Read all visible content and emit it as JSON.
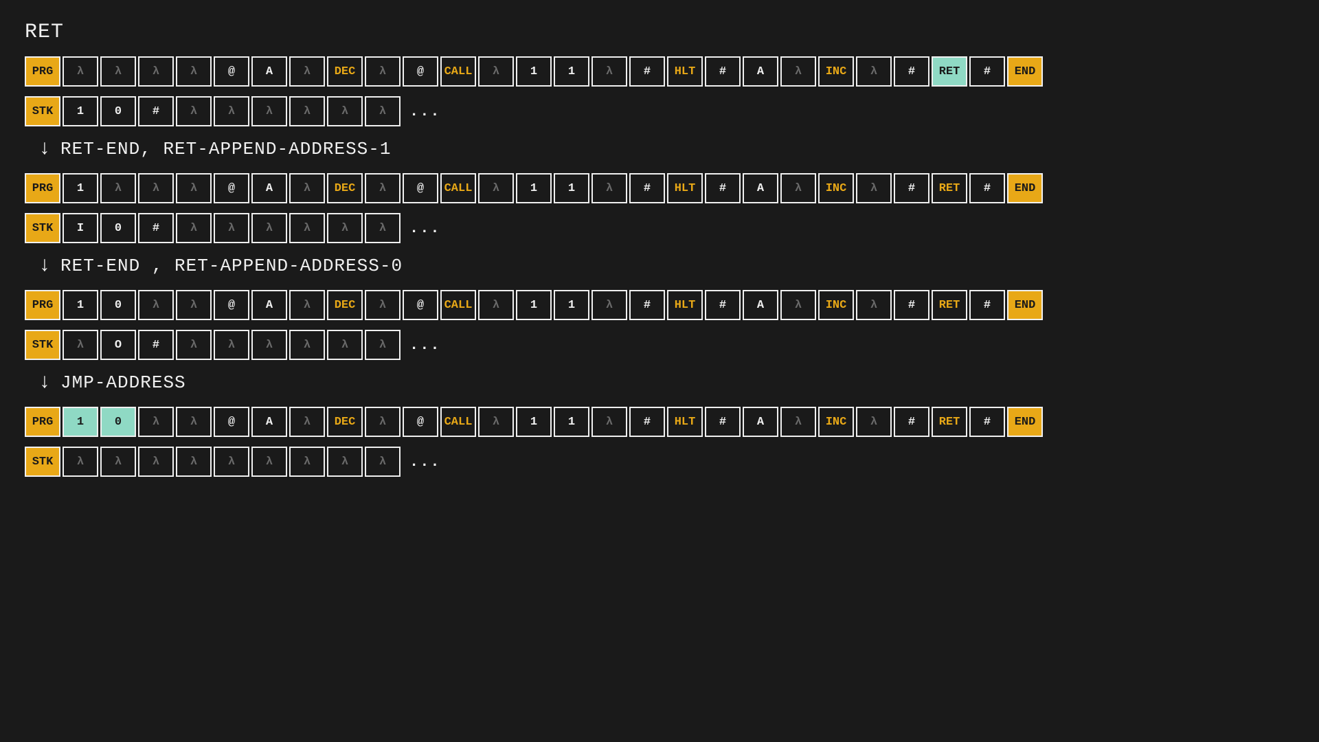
{
  "title": "RET",
  "ellipsis": "...",
  "labels": {
    "prg": "PRG",
    "stk": "STK"
  },
  "transitions": [
    "RET-END, RET-APPEND-ADDRESS-1",
    "RET-END , RET-APPEND-ADDRESS-0",
    "JMP-ADDRESS"
  ],
  "states": [
    {
      "prg": [
        {
          "t": "λ",
          "c": "dim"
        },
        {
          "t": "λ",
          "c": "dim"
        },
        {
          "t": "λ",
          "c": "dim"
        },
        {
          "t": "λ",
          "c": "dim"
        },
        {
          "t": "@",
          "c": ""
        },
        {
          "t": "A",
          "c": ""
        },
        {
          "t": "λ",
          "c": "dim"
        },
        {
          "t": "DEC",
          "c": "yellow"
        },
        {
          "t": "λ",
          "c": "dim"
        },
        {
          "t": "@",
          "c": ""
        },
        {
          "t": "CALL",
          "c": "yellow"
        },
        {
          "t": "λ",
          "c": "dim"
        },
        {
          "t": "1",
          "c": ""
        },
        {
          "t": "1",
          "c": ""
        },
        {
          "t": "λ",
          "c": "dim"
        },
        {
          "t": "#",
          "c": ""
        },
        {
          "t": "HLT",
          "c": "yellow"
        },
        {
          "t": "#",
          "c": ""
        },
        {
          "t": "A",
          "c": ""
        },
        {
          "t": "λ",
          "c": "dim"
        },
        {
          "t": "INC",
          "c": "yellow"
        },
        {
          "t": "λ",
          "c": "dim"
        },
        {
          "t": "#",
          "c": ""
        },
        {
          "t": "RET",
          "c": "highlight"
        },
        {
          "t": "#",
          "c": ""
        },
        {
          "t": "END",
          "c": "end"
        }
      ],
      "stk": [
        {
          "t": "1",
          "c": ""
        },
        {
          "t": "0",
          "c": ""
        },
        {
          "t": "#",
          "c": ""
        },
        {
          "t": "λ",
          "c": "dim"
        },
        {
          "t": "λ",
          "c": "dim"
        },
        {
          "t": "λ",
          "c": "dim"
        },
        {
          "t": "λ",
          "c": "dim"
        },
        {
          "t": "λ",
          "c": "dim"
        },
        {
          "t": "λ",
          "c": "dim"
        }
      ]
    },
    {
      "prg": [
        {
          "t": "1",
          "c": ""
        },
        {
          "t": "λ",
          "c": "dim"
        },
        {
          "t": "λ",
          "c": "dim"
        },
        {
          "t": "λ",
          "c": "dim"
        },
        {
          "t": "@",
          "c": ""
        },
        {
          "t": "A",
          "c": ""
        },
        {
          "t": "λ",
          "c": "dim"
        },
        {
          "t": "DEC",
          "c": "yellow"
        },
        {
          "t": "λ",
          "c": "dim"
        },
        {
          "t": "@",
          "c": ""
        },
        {
          "t": "CALL",
          "c": "yellow"
        },
        {
          "t": "λ",
          "c": "dim"
        },
        {
          "t": "1",
          "c": ""
        },
        {
          "t": "1",
          "c": ""
        },
        {
          "t": "λ",
          "c": "dim"
        },
        {
          "t": "#",
          "c": ""
        },
        {
          "t": "HLT",
          "c": "yellow"
        },
        {
          "t": "#",
          "c": ""
        },
        {
          "t": "A",
          "c": ""
        },
        {
          "t": "λ",
          "c": "dim"
        },
        {
          "t": "INC",
          "c": "yellow"
        },
        {
          "t": "λ",
          "c": "dim"
        },
        {
          "t": "#",
          "c": ""
        },
        {
          "t": "RET",
          "c": "yellow"
        },
        {
          "t": "#",
          "c": ""
        },
        {
          "t": "END",
          "c": "end"
        }
      ],
      "stk": [
        {
          "t": "I",
          "c": ""
        },
        {
          "t": "0",
          "c": ""
        },
        {
          "t": "#",
          "c": ""
        },
        {
          "t": "λ",
          "c": "dim"
        },
        {
          "t": "λ",
          "c": "dim"
        },
        {
          "t": "λ",
          "c": "dim"
        },
        {
          "t": "λ",
          "c": "dim"
        },
        {
          "t": "λ",
          "c": "dim"
        },
        {
          "t": "λ",
          "c": "dim"
        }
      ]
    },
    {
      "prg": [
        {
          "t": "1",
          "c": ""
        },
        {
          "t": "0",
          "c": ""
        },
        {
          "t": "λ",
          "c": "dim"
        },
        {
          "t": "λ",
          "c": "dim"
        },
        {
          "t": "@",
          "c": ""
        },
        {
          "t": "A",
          "c": ""
        },
        {
          "t": "λ",
          "c": "dim"
        },
        {
          "t": "DEC",
          "c": "yellow"
        },
        {
          "t": "λ",
          "c": "dim"
        },
        {
          "t": "@",
          "c": ""
        },
        {
          "t": "CALL",
          "c": "yellow"
        },
        {
          "t": "λ",
          "c": "dim"
        },
        {
          "t": "1",
          "c": ""
        },
        {
          "t": "1",
          "c": ""
        },
        {
          "t": "λ",
          "c": "dim"
        },
        {
          "t": "#",
          "c": ""
        },
        {
          "t": "HLT",
          "c": "yellow"
        },
        {
          "t": "#",
          "c": ""
        },
        {
          "t": "A",
          "c": ""
        },
        {
          "t": "λ",
          "c": "dim"
        },
        {
          "t": "INC",
          "c": "yellow"
        },
        {
          "t": "λ",
          "c": "dim"
        },
        {
          "t": "#",
          "c": ""
        },
        {
          "t": "RET",
          "c": "yellow"
        },
        {
          "t": "#",
          "c": ""
        },
        {
          "t": "END",
          "c": "end"
        }
      ],
      "stk": [
        {
          "t": "λ",
          "c": "dim"
        },
        {
          "t": "O",
          "c": ""
        },
        {
          "t": "#",
          "c": ""
        },
        {
          "t": "λ",
          "c": "dim"
        },
        {
          "t": "λ",
          "c": "dim"
        },
        {
          "t": "λ",
          "c": "dim"
        },
        {
          "t": "λ",
          "c": "dim"
        },
        {
          "t": "λ",
          "c": "dim"
        },
        {
          "t": "λ",
          "c": "dim"
        }
      ]
    },
    {
      "prg": [
        {
          "t": "1",
          "c": "highlight"
        },
        {
          "t": "0",
          "c": "highlight"
        },
        {
          "t": "λ",
          "c": "dim"
        },
        {
          "t": "λ",
          "c": "dim"
        },
        {
          "t": "@",
          "c": ""
        },
        {
          "t": "A",
          "c": ""
        },
        {
          "t": "λ",
          "c": "dim"
        },
        {
          "t": "DEC",
          "c": "yellow"
        },
        {
          "t": "λ",
          "c": "dim"
        },
        {
          "t": "@",
          "c": ""
        },
        {
          "t": "CALL",
          "c": "yellow"
        },
        {
          "t": "λ",
          "c": "dim"
        },
        {
          "t": "1",
          "c": ""
        },
        {
          "t": "1",
          "c": ""
        },
        {
          "t": "λ",
          "c": "dim"
        },
        {
          "t": "#",
          "c": ""
        },
        {
          "t": "HLT",
          "c": "yellow"
        },
        {
          "t": "#",
          "c": ""
        },
        {
          "t": "A",
          "c": ""
        },
        {
          "t": "λ",
          "c": "dim"
        },
        {
          "t": "INC",
          "c": "yellow"
        },
        {
          "t": "λ",
          "c": "dim"
        },
        {
          "t": "#",
          "c": ""
        },
        {
          "t": "RET",
          "c": "yellow"
        },
        {
          "t": "#",
          "c": ""
        },
        {
          "t": "END",
          "c": "end"
        }
      ],
      "stk": [
        {
          "t": "λ",
          "c": "dim"
        },
        {
          "t": "λ",
          "c": "dim"
        },
        {
          "t": "λ",
          "c": "dim"
        },
        {
          "t": "λ",
          "c": "dim"
        },
        {
          "t": "λ",
          "c": "dim"
        },
        {
          "t": "λ",
          "c": "dim"
        },
        {
          "t": "λ",
          "c": "dim"
        },
        {
          "t": "λ",
          "c": "dim"
        },
        {
          "t": "λ",
          "c": "dim"
        }
      ]
    }
  ]
}
